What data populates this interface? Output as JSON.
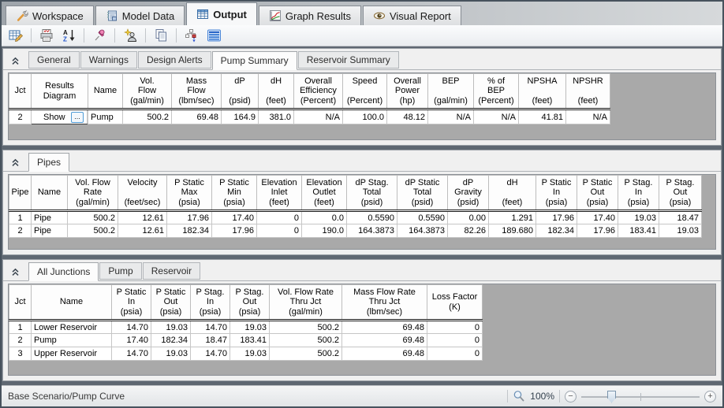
{
  "doc_tabs": [
    {
      "label": "Workspace"
    },
    {
      "label": "Model Data"
    },
    {
      "label": "Output"
    },
    {
      "label": "Graph Results"
    },
    {
      "label": "Visual Report"
    }
  ],
  "toolbar": {
    "icons": [
      "output-control-icon",
      "print-icon",
      "sort-az-icon",
      "pin-icon",
      "wizard-icon",
      "copy-icon",
      "transfer-results-icon",
      "show-tables-icon"
    ]
  },
  "pump_summary_panel": {
    "tabs": [
      {
        "label": "General"
      },
      {
        "label": "Warnings"
      },
      {
        "label": "Design Alerts"
      },
      {
        "label": "Pump Summary",
        "active": true
      },
      {
        "label": "Reservoir Summary"
      }
    ],
    "table": {
      "headers": [
        "Jct",
        "Results\nDiagram",
        "Name",
        "Vol.\nFlow\n(gal/min)",
        "Mass\nFlow\n(lbm/sec)",
        "dP\n\n(psid)",
        "dH\n\n(feet)",
        "Overall\nEfficiency\n(Percent)",
        "Speed\n\n(Percent)",
        "Overall\nPower\n(hp)",
        "BEP\n\n(gal/min)",
        "% of\nBEP\n(Percent)",
        "NPSHA\n\n(feet)",
        "NPSHR\n\n(feet)"
      ],
      "show_button_label": "...",
      "rows": [
        [
          "2",
          "Show",
          "Pump",
          "500.2",
          "69.48",
          "164.9",
          "381.0",
          "N/A",
          "100.0",
          "48.12",
          "N/A",
          "N/A",
          "41.81",
          "N/A"
        ]
      ]
    }
  },
  "pipes_panel": {
    "tabs": [
      {
        "label": "Pipes",
        "active": true
      }
    ],
    "table": {
      "headers": [
        "Pipe",
        "Name",
        "Vol. Flow\nRate\n(gal/min)",
        "Velocity\n\n(feet/sec)",
        "P Static\nMax\n(psia)",
        "P Static\nMin\n(psia)",
        "Elevation\nInlet\n(feet)",
        "Elevation\nOutlet\n(feet)",
        "dP Stag.\nTotal\n(psid)",
        "dP Static\nTotal\n(psid)",
        "dP\nGravity\n(psid)",
        "dH\n\n(feet)",
        "P Static\nIn\n(psia)",
        "P Static\nOut\n(psia)",
        "P Stag.\nIn\n(psia)",
        "P Stag.\nOut\n(psia)"
      ],
      "rows": [
        [
          "1",
          "Pipe",
          "500.2",
          "12.61",
          "17.96",
          "17.40",
          "0",
          "0.0",
          "0.5590",
          "0.5590",
          "0.00",
          "1.291",
          "17.96",
          "17.40",
          "19.03",
          "18.47"
        ],
        [
          "2",
          "Pipe",
          "500.2",
          "12.61",
          "182.34",
          "17.96",
          "0",
          "190.0",
          "164.3873",
          "164.3873",
          "82.26",
          "189.680",
          "182.34",
          "17.96",
          "183.41",
          "19.03"
        ]
      ]
    }
  },
  "junctions_panel": {
    "tabs": [
      {
        "label": "All Junctions",
        "active": true
      },
      {
        "label": "Pump"
      },
      {
        "label": "Reservoir"
      }
    ],
    "table": {
      "headers": [
        "Jct",
        "Name",
        "P Static\nIn\n(psia)",
        "P Static\nOut\n(psia)",
        "P Stag.\nIn\n(psia)",
        "P Stag.\nOut\n(psia)",
        "Vol. Flow Rate\nThru Jct\n(gal/min)",
        "Mass Flow Rate\nThru Jct\n(lbm/sec)",
        "Loss Factor\n(K)"
      ],
      "rows": [
        [
          "1",
          "Lower Reservoir",
          "14.70",
          "19.03",
          "14.70",
          "19.03",
          "500.2",
          "69.48",
          "0"
        ],
        [
          "2",
          "Pump",
          "17.40",
          "182.34",
          "18.47",
          "183.41",
          "500.2",
          "69.48",
          "0"
        ],
        [
          "3",
          "Upper Reservoir",
          "14.70",
          "19.03",
          "14.70",
          "19.03",
          "500.2",
          "69.48",
          "0"
        ]
      ]
    }
  },
  "statusbar": {
    "scenario_path": "Base Scenario/Pump Curve",
    "zoom_level": "100%",
    "zoom_minus": "−",
    "zoom_plus": "+"
  }
}
